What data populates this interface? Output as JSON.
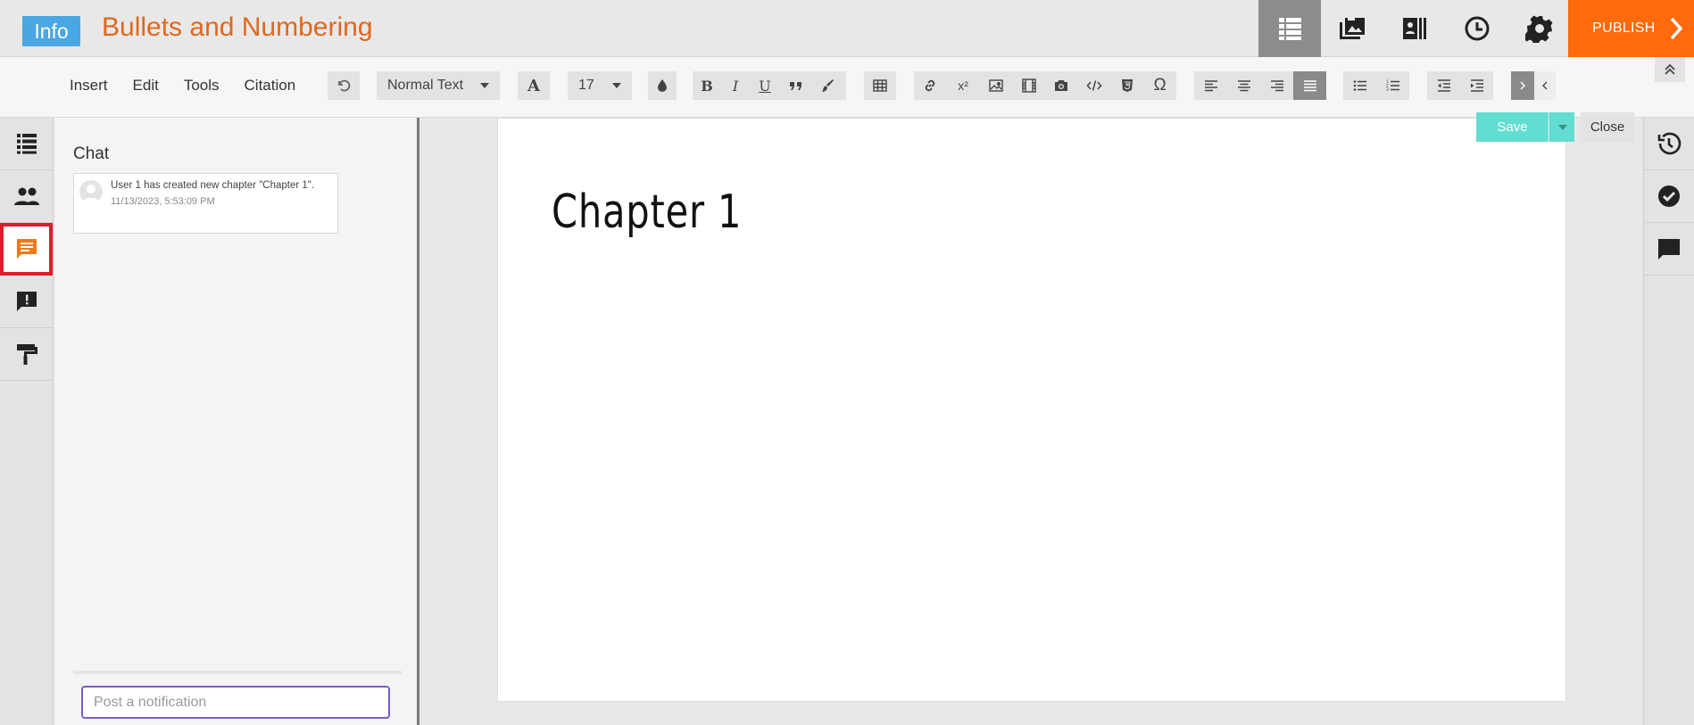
{
  "header": {
    "info_label": "Info",
    "title": "Bullets and Numbering",
    "icons": [
      "chapters-list-icon",
      "media-gallery-icon",
      "contacts-book-icon",
      "history-clock-icon",
      "settings-gear-icon"
    ],
    "publish_label": "PUBLISH"
  },
  "toolbar": {
    "menu": [
      "Insert",
      "Edit",
      "Tools",
      "Citation"
    ],
    "style_select": "Normal Text",
    "font_size": "17",
    "bold": "B",
    "italic": "I",
    "underline": "U",
    "superscript": "x²",
    "omega": "Ω",
    "font_a": "A"
  },
  "left_rail": {
    "items": [
      "chapters-icon",
      "people-icon",
      "chat-icon",
      "feedback-icon",
      "paint-roller-icon"
    ],
    "active": "chat-icon"
  },
  "chat": {
    "title": "Chat",
    "messages": [
      {
        "text": "User 1 has created new chapter \"Chapter 1\".",
        "time": "11/13/2023, 5:53:09 PM"
      }
    ],
    "input_placeholder": "Post a notification"
  },
  "editor": {
    "chapter_title": "Chapter 1",
    "save_label": "Save",
    "close_label": "Close"
  },
  "right_rail": {
    "items": [
      "history-icon",
      "check-circle-icon",
      "comment-icon"
    ]
  },
  "colors": {
    "accent_orange": "#ff6a0c",
    "title_orange": "#e0681d",
    "info_blue": "#4aa7e3",
    "save_teal": "#63ddd1",
    "active_rail_outline": "#e01b2d"
  }
}
